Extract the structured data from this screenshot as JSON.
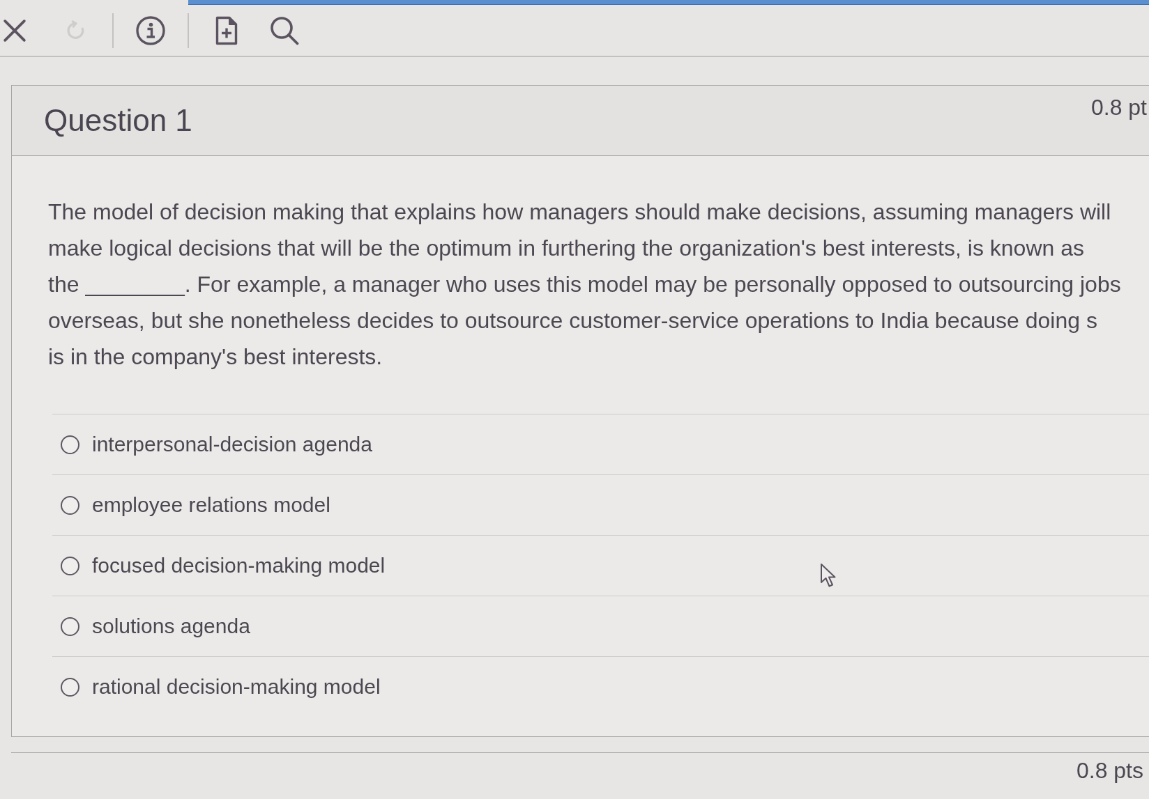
{
  "toolbar": {
    "groups": [
      [
        {
          "kind": "close",
          "disabled": false
        },
        {
          "kind": "refresh",
          "disabled": true
        }
      ],
      [
        {
          "kind": "info",
          "disabled": false
        }
      ],
      [
        {
          "kind": "new-document",
          "disabled": false
        },
        {
          "kind": "search",
          "disabled": false
        }
      ]
    ]
  },
  "question": {
    "title": "Question 1",
    "points": "0.8 pt",
    "text_lines": [
      "The model of decision making that explains how managers should make decisions, assuming managers will",
      "make logical decisions that will be the optimum in furthering the organization's best interests, is known as",
      "the ________. For example, a manager who uses this model may be personally opposed to outsourcing jobs",
      "overseas, but she nonetheless decides to outsource customer-service operations to India because doing s",
      "is in the company's best interests."
    ],
    "options": [
      {
        "label": "interpersonal-decision agenda",
        "selected": false
      },
      {
        "label": "employee relations model",
        "selected": false
      },
      {
        "label": "focused decision-making model",
        "selected": false
      },
      {
        "label": "solutions agenda",
        "selected": false
      },
      {
        "label": "rational decision-making model",
        "selected": false
      }
    ]
  },
  "next_question": {
    "points": "0.8 pts"
  }
}
